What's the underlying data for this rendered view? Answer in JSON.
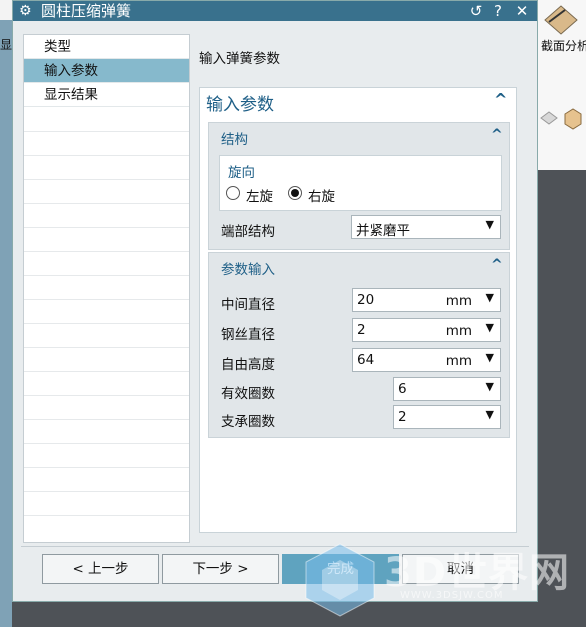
{
  "window": {
    "title": "圆柱压缩弹簧",
    "reset_icon": "↺",
    "help_label": "?",
    "close_label": "✕"
  },
  "background": {
    "left_label": "显",
    "right_label": "截面分析"
  },
  "nav": {
    "items": [
      {
        "label": "类型"
      },
      {
        "label": "输入参数"
      },
      {
        "label": "显示结果"
      }
    ]
  },
  "page": {
    "title": "输入弹簧参数",
    "panel_title": "输入参数",
    "structure": {
      "header": "结构",
      "rotation_label": "旋向",
      "left_label": "左旋",
      "right_label": "右旋",
      "selected": "右旋",
      "end_label": "端部结构",
      "end_value": "并紧磨平"
    },
    "params": {
      "header": "参数输入",
      "mid_diameter_label": "中间直径",
      "mid_diameter_value": "20",
      "mid_diameter_unit": "mm",
      "wire_diameter_label": "钢丝直径",
      "wire_diameter_value": "2",
      "wire_diameter_unit": "mm",
      "free_height_label": "自由高度",
      "free_height_value": "64",
      "free_height_unit": "mm",
      "effective_coils_label": "有效圈数",
      "effective_coils_value": "6",
      "support_coils_label": "支承圈数",
      "support_coils_value": "2"
    }
  },
  "buttons": {
    "prev": "< 上一步",
    "next": "下一步 >",
    "finish": "完成",
    "cancel": "取消"
  },
  "watermark": {
    "text": "3D世界网",
    "url": "WWW.3DSJW.COM"
  }
}
